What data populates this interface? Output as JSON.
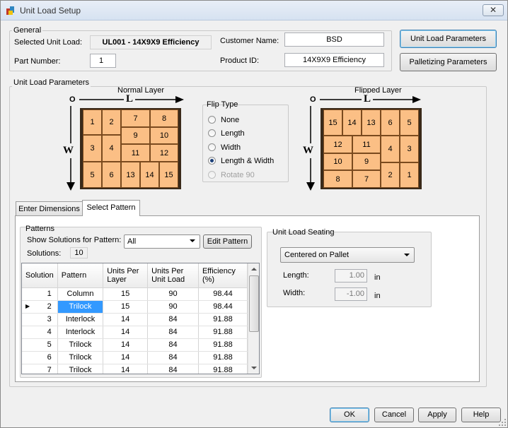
{
  "window": {
    "title": "Unit Load Setup",
    "close_glyph": "✕"
  },
  "general": {
    "group_label": "General",
    "selected_unit_load_label": "Selected Unit Load:",
    "selected_unit_load_value": "UL001 - 14X9X9 Efficiency",
    "part_number_label": "Part Number:",
    "part_number_value": "1",
    "customer_name_label": "Customer Name:",
    "customer_name_value": "BSD",
    "product_id_label": "Product ID:",
    "product_id_value": "14X9X9 Efficiency"
  },
  "side_buttons": {
    "unit_load_parameters": "Unit Load Parameters",
    "palletizing_parameters": "Palletizing Parameters"
  },
  "ulp": {
    "group_label": "Unit Load Parameters",
    "normal_layer_label": "Normal Layer",
    "flipped_layer_label": "Flipped Layer",
    "origin": "O",
    "l_label": "L",
    "w_label": "W",
    "normal_boxes": [
      "1",
      "2",
      "7",
      "8",
      "9",
      "10",
      "3",
      "4",
      "11",
      "12",
      "5",
      "6",
      "13",
      "14",
      "15"
    ],
    "flipped_boxes": [
      "15",
      "14",
      "13",
      "6",
      "5",
      "12",
      "11",
      "4",
      "3",
      "10",
      "9",
      "8",
      "7",
      "2",
      "1"
    ]
  },
  "flip_type": {
    "label": "Flip Type",
    "options": [
      "None",
      "Length",
      "Width",
      "Length & Width",
      "Rotate 90"
    ],
    "selected": "Length & Width"
  },
  "tabs": [
    {
      "label": "Enter Dimensions"
    },
    {
      "label": "Select Pattern"
    }
  ],
  "patterns": {
    "group_label": "Patterns",
    "show_solutions_label": "Show Solutions for Pattern:",
    "show_solutions_value": "All",
    "edit_pattern_button": "Edit Pattern",
    "solutions_label": "Solutions:",
    "solutions_value": "10",
    "columns": [
      "Solution",
      "Pattern",
      "Units Per Layer",
      "Units Per Unit Load",
      "Efficiency (%)"
    ],
    "rows": [
      [
        "1",
        "Column",
        "15",
        "90",
        "98.44"
      ],
      [
        "2",
        "Trilock",
        "15",
        "90",
        "98.44"
      ],
      [
        "3",
        "Interlock",
        "14",
        "84",
        "91.88"
      ],
      [
        "4",
        "Interlock",
        "14",
        "84",
        "91.88"
      ],
      [
        "5",
        "Trilock",
        "14",
        "84",
        "91.88"
      ],
      [
        "6",
        "Trilock",
        "14",
        "84",
        "91.88"
      ],
      [
        "7",
        "Trilock",
        "14",
        "84",
        "91.88"
      ]
    ],
    "selected_row": "2",
    "row_pointer": "▶"
  },
  "seating": {
    "group_label": "Unit Load Seating",
    "select_value": "Centered on Pallet",
    "length_label": "Length:",
    "length_value": "1.00",
    "width_label": "Width:",
    "width_value": "-1.00",
    "unit": "in"
  },
  "footer": {
    "ok": "OK",
    "cancel": "Cancel",
    "apply": "Apply",
    "help": "Help"
  }
}
